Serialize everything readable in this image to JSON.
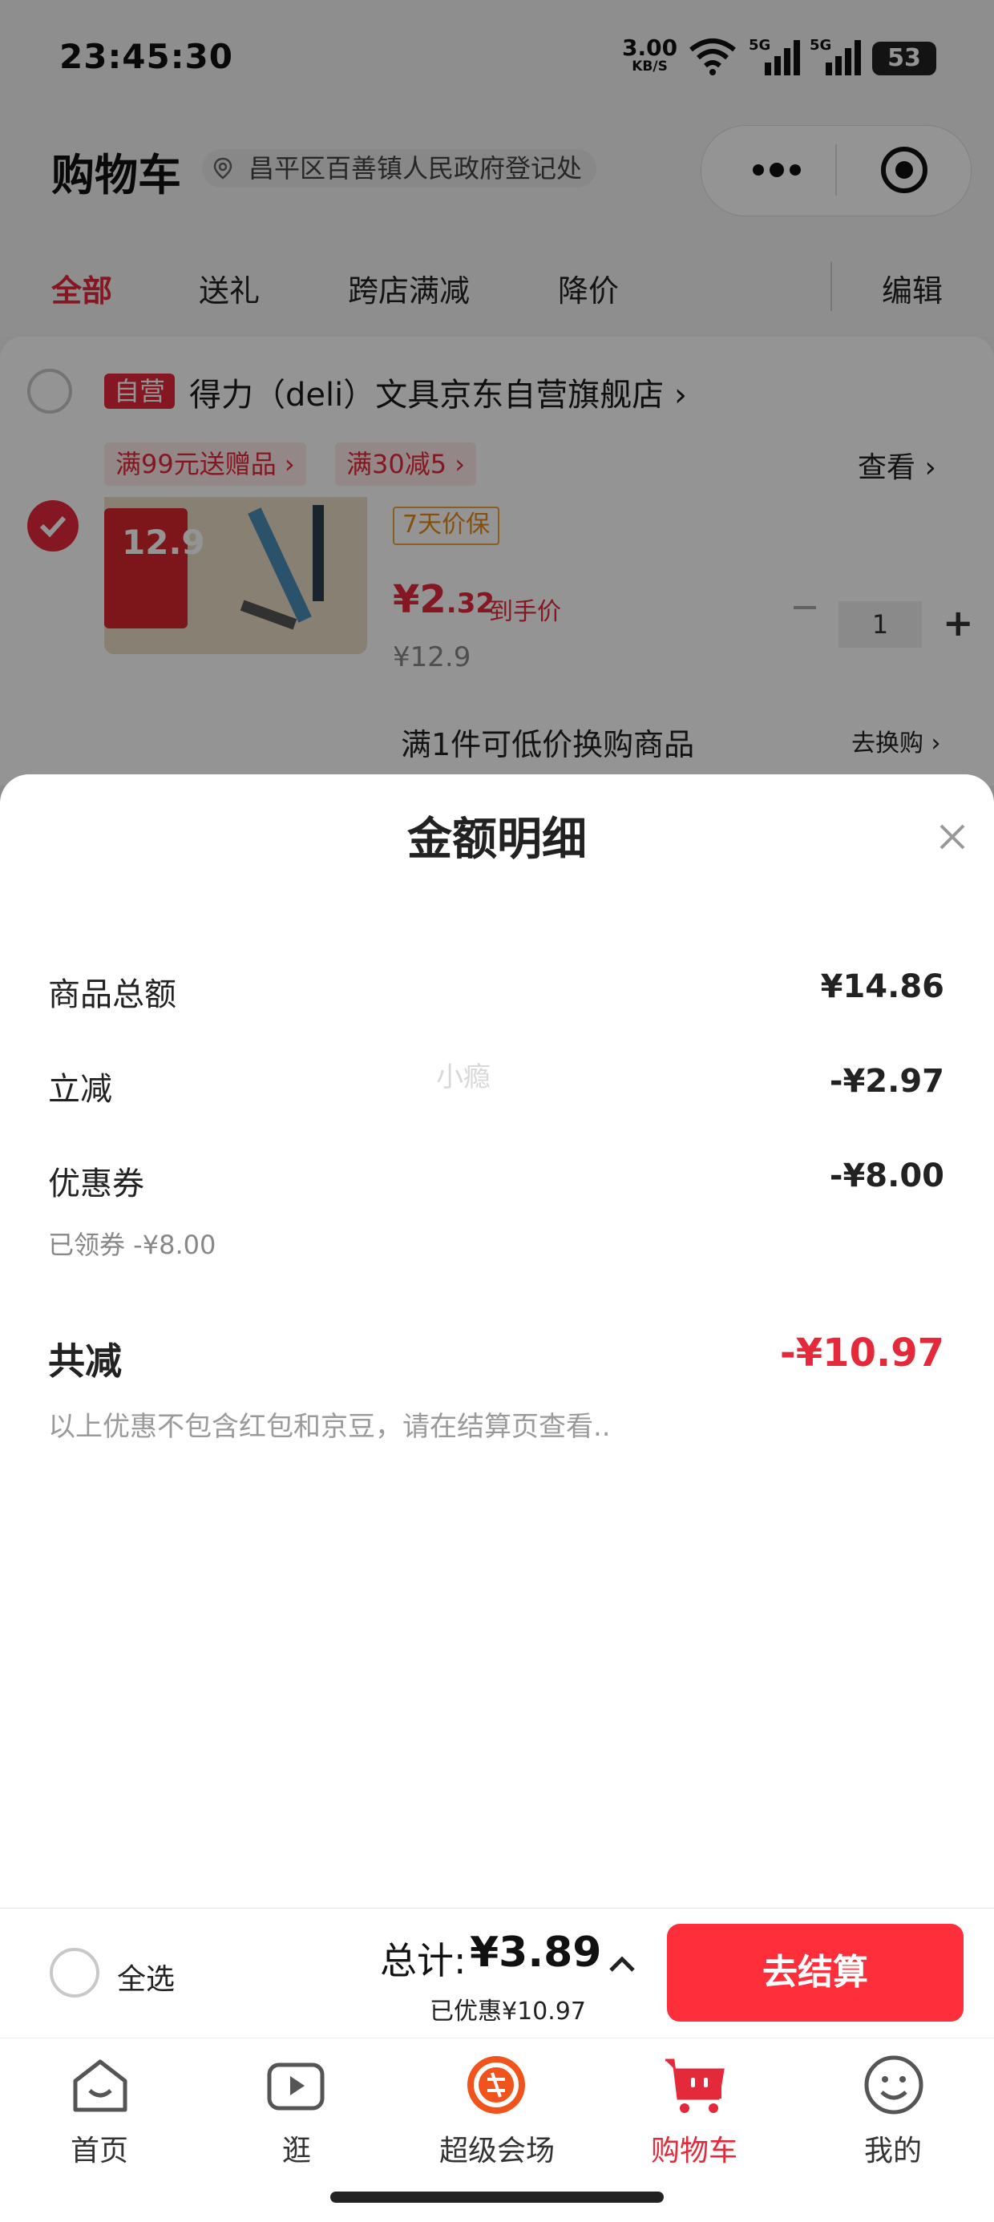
{
  "status_bar": {
    "time": "23:45:30",
    "net_speed": "3.00",
    "net_unit": "KB/S",
    "battery": "53"
  },
  "header": {
    "title": "购物车",
    "location": "昌平区百善镇人民政府登记处"
  },
  "tabs": [
    {
      "label": "全部",
      "active": true
    },
    {
      "label": "送礼",
      "active": false
    },
    {
      "label": "跨店满减",
      "active": false
    },
    {
      "label": "降价",
      "active": false
    }
  ],
  "edit_label": "编辑",
  "store": {
    "self_tag": "自营",
    "name": "得力（deli）文具京东自营旗舰店 ›",
    "promos": [
      "满99元送赠品 ›",
      "满30减5 ›"
    ],
    "view_label": "查看 ›"
  },
  "item": {
    "thumb_price": "12.9",
    "badge": "7天价保",
    "price_int": "¥2",
    "price_dec": ".32",
    "price_note": "到手价",
    "old_price": "¥12.9",
    "quantity": "1",
    "swap_text": "满1件可低价换购商品",
    "swap_link": "去换购 ›"
  },
  "sheet": {
    "title": "金额明细",
    "rows": [
      {
        "label": "商品总额",
        "value": "¥14.86"
      },
      {
        "label": "立减",
        "value": "-¥2.97"
      },
      {
        "label": "优惠券",
        "value": "-¥8.00"
      }
    ],
    "coupon_sub": "已领券 -¥8.00",
    "total_label": "共减",
    "total_value": "-¥10.97",
    "note": "以上优惠不包含红包和京豆，请在结算页查看..",
    "watermark": "小瘾"
  },
  "footer": {
    "select_all": "全选",
    "sum_label": "总计:",
    "sum_value": "¥3.89",
    "saved": "已优惠¥10.97",
    "checkout": "去结算"
  },
  "tabbar": [
    {
      "label": "首页",
      "icon": "home-icon"
    },
    {
      "label": "逛",
      "icon": "video-icon"
    },
    {
      "label": "超级会场",
      "icon": "super-venue-icon"
    },
    {
      "label": "购物车",
      "icon": "cart-icon",
      "active": true
    },
    {
      "label": "我的",
      "icon": "profile-icon"
    }
  ],
  "colors": {
    "accent": "#e4293a",
    "checkout": "#ff2e3b"
  }
}
